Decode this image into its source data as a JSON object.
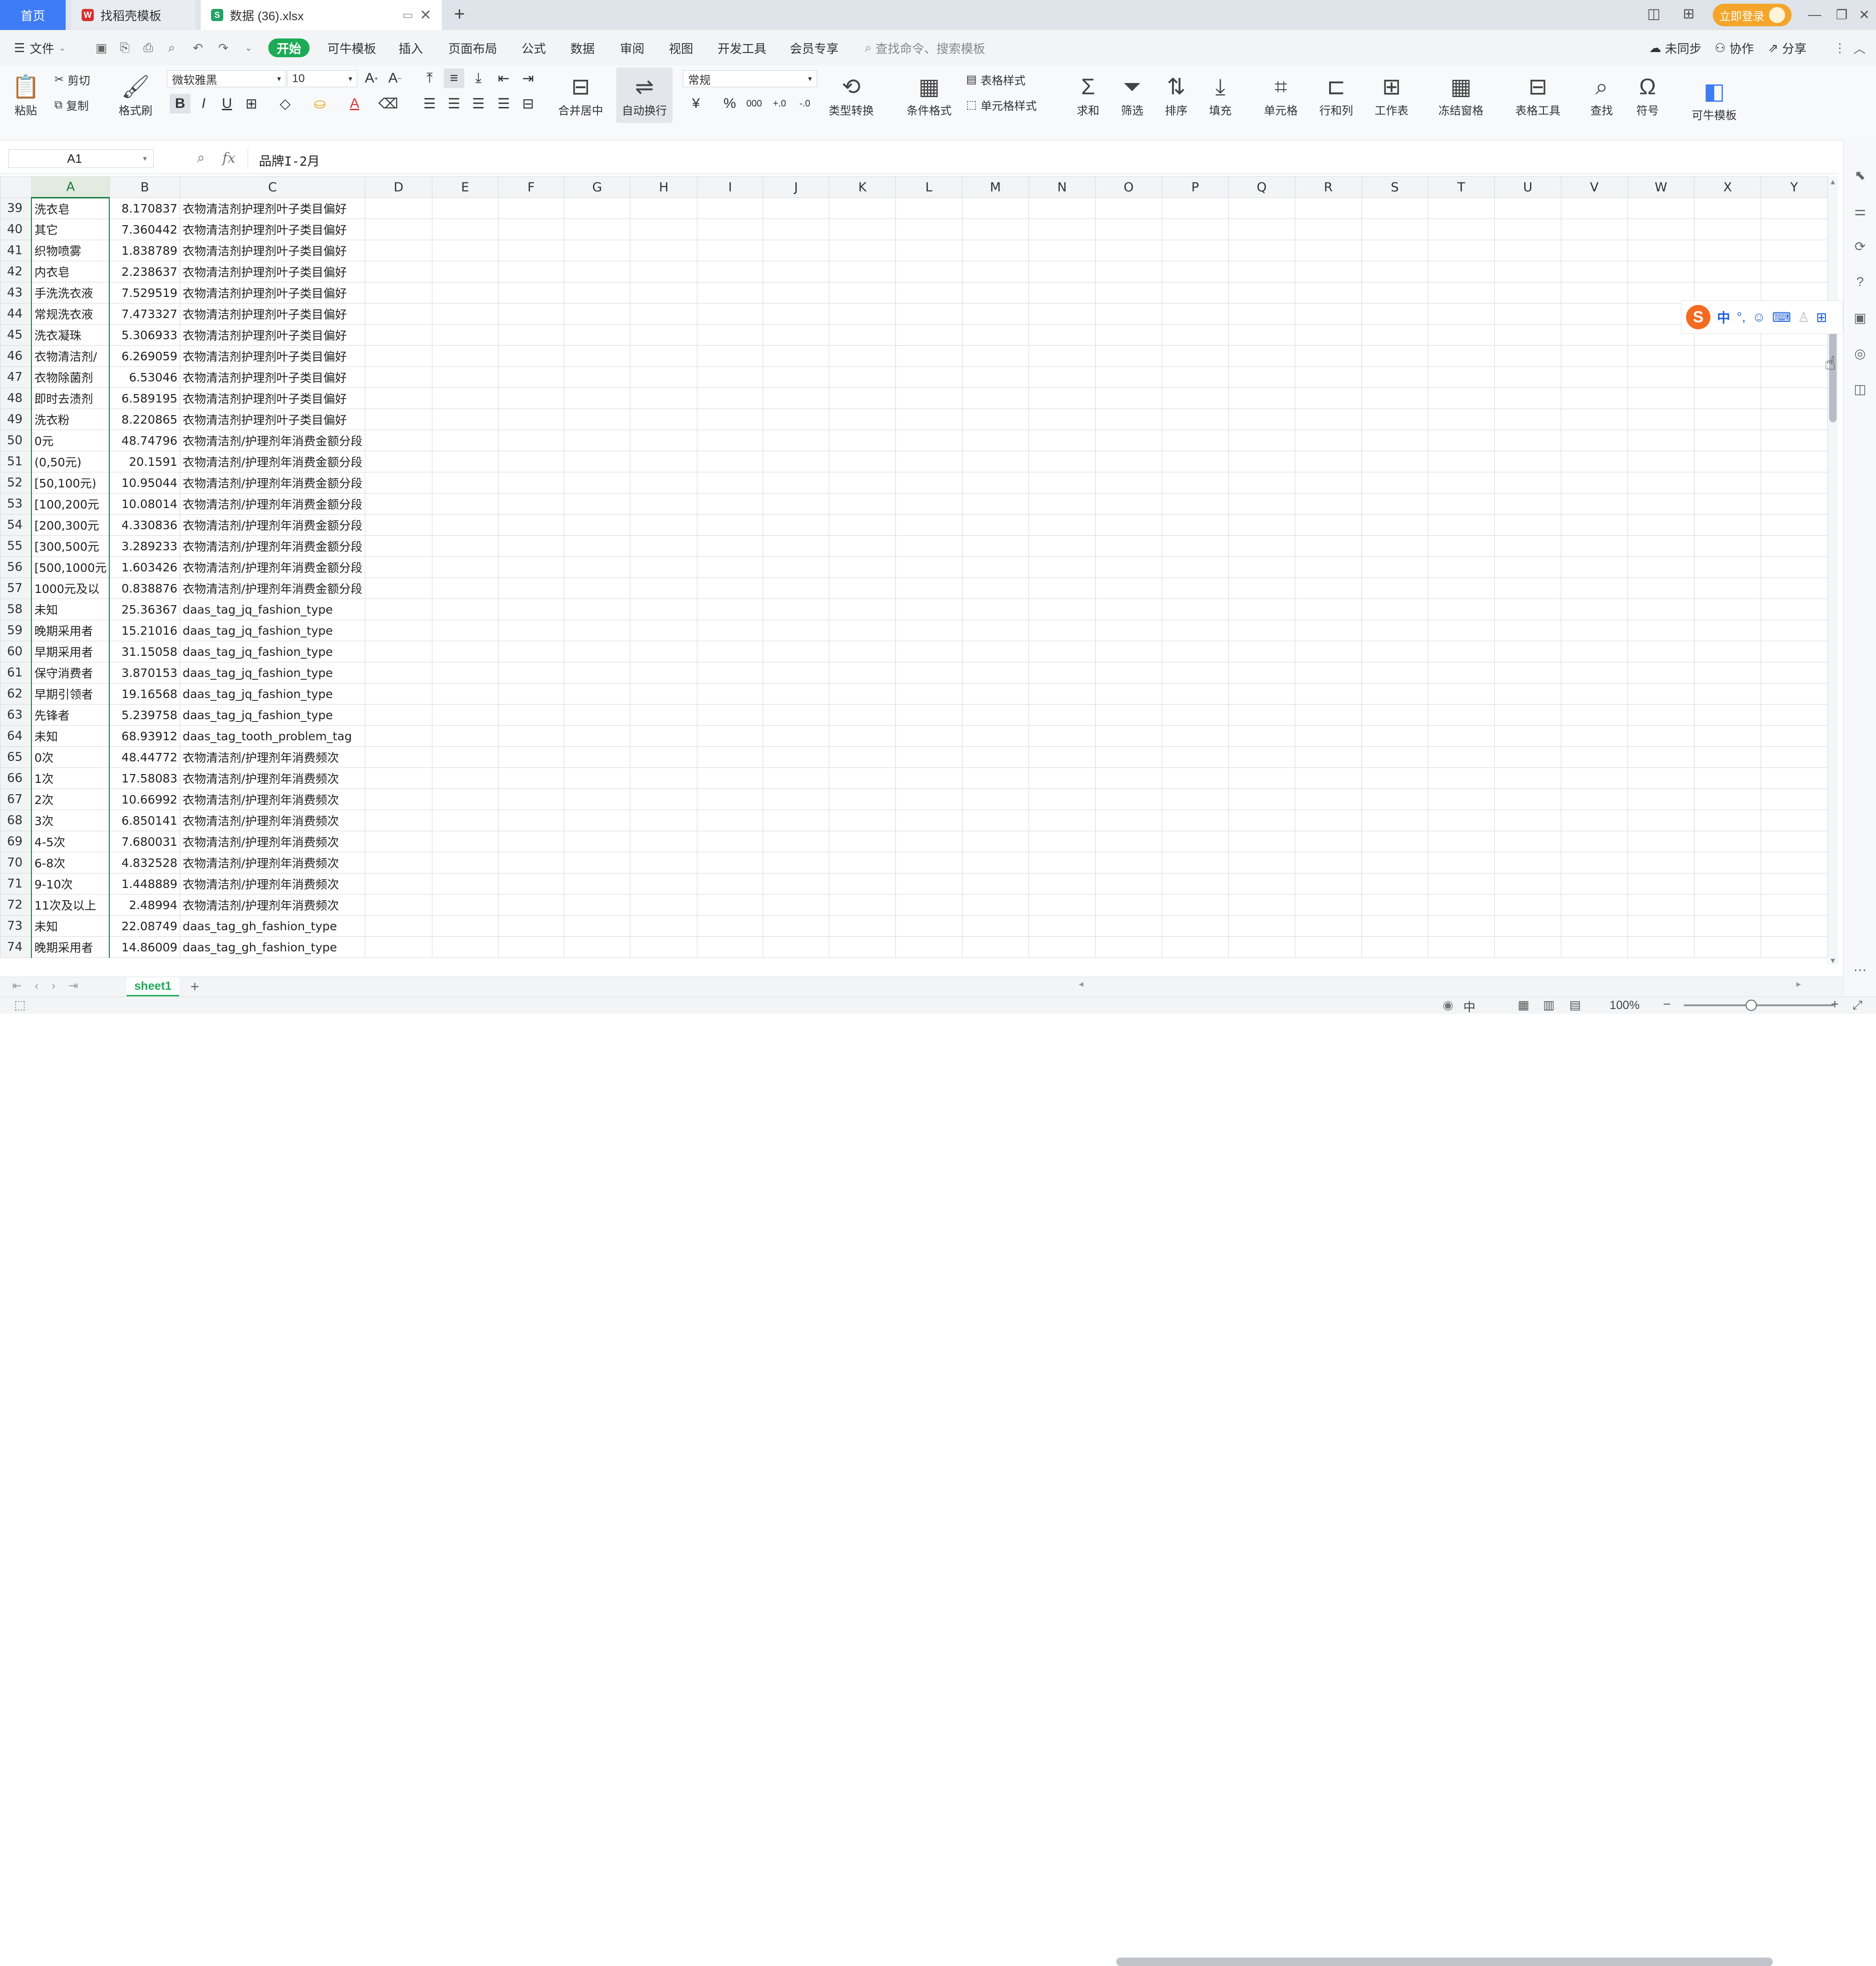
{
  "titlebar": {
    "tabs": [
      {
        "label": "首页"
      },
      {
        "label": "找稻壳模板"
      },
      {
        "label": "数据 (36).xlsx"
      }
    ],
    "new_tab": "+",
    "login_button": "立即登录"
  },
  "menubar": {
    "file": "文件",
    "items": [
      "开始",
      "可牛模板",
      "插入",
      "页面布局",
      "公式",
      "数据",
      "审阅",
      "视图",
      "开发工具",
      "会员专享"
    ],
    "search_placeholder": "查找命令、搜索模板",
    "right": [
      "未同步",
      "协作",
      "分享"
    ]
  },
  "ribbon": {
    "paste": "粘贴",
    "cut": "剪切",
    "copy": "复制",
    "format_painter": "格式刷",
    "font_name": "微软雅黑",
    "font_size": "10",
    "merge": "合并居中",
    "wrap": "自动换行",
    "number_format": "常规",
    "type_convert": "类型转换",
    "cond_format": "条件格式",
    "table_style": "表格样式",
    "cell_style": "单元格样式",
    "sum": "求和",
    "filter": "筛选",
    "sort": "排序",
    "fill": "填充",
    "cell": "单元格",
    "rowcol": "行和列",
    "worksheet": "工作表",
    "freeze": "冻结窗格",
    "table_tools": "表格工具",
    "find": "查找",
    "symbol": "符号",
    "keniu": "可牛模板"
  },
  "formula": {
    "name_box": "A1",
    "fx": "fx",
    "content": "品牌I-2月"
  },
  "columns": [
    "A",
    "B",
    "C",
    "D",
    "E",
    "F",
    "G",
    "H",
    "I",
    "J",
    "K",
    "L",
    "M",
    "N",
    "O",
    "P",
    "Q",
    "R",
    "S",
    "T",
    "U",
    "V",
    "W",
    "X",
    "Y"
  ],
  "rows": [
    {
      "n": "39",
      "a": "洗衣皂",
      "b": "8.170837",
      "c": "衣物清洁剂护理剂叶子类目偏好"
    },
    {
      "n": "40",
      "a": "其它",
      "b": "7.360442",
      "c": "衣物清洁剂护理剂叶子类目偏好"
    },
    {
      "n": "41",
      "a": "织物喷雾",
      "b": "1.838789",
      "c": "衣物清洁剂护理剂叶子类目偏好"
    },
    {
      "n": "42",
      "a": "内衣皂",
      "b": "2.238637",
      "c": "衣物清洁剂护理剂叶子类目偏好"
    },
    {
      "n": "43",
      "a": "手洗洗衣液",
      "b": "7.529519",
      "c": "衣物清洁剂护理剂叶子类目偏好"
    },
    {
      "n": "44",
      "a": "常规洗衣液",
      "b": "7.473327",
      "c": "衣物清洁剂护理剂叶子类目偏好"
    },
    {
      "n": "45",
      "a": "洗衣凝珠",
      "b": "5.306933",
      "c": "衣物清洁剂护理剂叶子类目偏好"
    },
    {
      "n": "46",
      "a": "衣物清洁剂/",
      "b": "6.269059",
      "c": "衣物清洁剂护理剂叶子类目偏好"
    },
    {
      "n": "47",
      "a": "衣物除菌剂",
      "b": "6.53046",
      "c": "衣物清洁剂护理剂叶子类目偏好"
    },
    {
      "n": "48",
      "a": "即时去渍剂",
      "b": "6.589195",
      "c": "衣物清洁剂护理剂叶子类目偏好"
    },
    {
      "n": "49",
      "a": "洗衣粉",
      "b": "8.220865",
      "c": "衣物清洁剂护理剂叶子类目偏好"
    },
    {
      "n": "50",
      "a": "0元",
      "b": "48.74796",
      "c": "衣物清洁剂/护理剂年消费金额分段"
    },
    {
      "n": "51",
      "a": "(0,50元)",
      "b": "20.1591",
      "c": "衣物清洁剂/护理剂年消费金额分段"
    },
    {
      "n": "52",
      "a": "[50,100元)",
      "b": "10.95044",
      "c": "衣物清洁剂/护理剂年消费金额分段"
    },
    {
      "n": "53",
      "a": "[100,200元",
      "b": "10.08014",
      "c": "衣物清洁剂/护理剂年消费金额分段"
    },
    {
      "n": "54",
      "a": "[200,300元",
      "b": "4.330836",
      "c": "衣物清洁剂/护理剂年消费金额分段"
    },
    {
      "n": "55",
      "a": "[300,500元",
      "b": "3.289233",
      "c": "衣物清洁剂/护理剂年消费金额分段"
    },
    {
      "n": "56",
      "a": "[500,1000元",
      "b": "1.603426",
      "c": "衣物清洁剂/护理剂年消费金额分段"
    },
    {
      "n": "57",
      "a": "1000元及以",
      "b": "0.838876",
      "c": "衣物清洁剂/护理剂年消费金额分段"
    },
    {
      "n": "58",
      "a": "未知",
      "b": "25.36367",
      "c": "daas_tag_jq_fashion_type"
    },
    {
      "n": "59",
      "a": "晚期采用者",
      "b": "15.21016",
      "c": "daas_tag_jq_fashion_type"
    },
    {
      "n": "60",
      "a": "早期采用者",
      "b": "31.15058",
      "c": "daas_tag_jq_fashion_type"
    },
    {
      "n": "61",
      "a": "保守消费者",
      "b": "3.870153",
      "c": "daas_tag_jq_fashion_type"
    },
    {
      "n": "62",
      "a": "早期引领者",
      "b": "19.16568",
      "c": "daas_tag_jq_fashion_type"
    },
    {
      "n": "63",
      "a": "先锋者",
      "b": "5.239758",
      "c": "daas_tag_jq_fashion_type"
    },
    {
      "n": "64",
      "a": "未知",
      "b": "68.93912",
      "c": "daas_tag_tooth_problem_tag"
    },
    {
      "n": "65",
      "a": "0次",
      "b": "48.44772",
      "c": "衣物清洁剂/护理剂年消费频次"
    },
    {
      "n": "66",
      "a": "1次",
      "b": "17.58083",
      "c": "衣物清洁剂/护理剂年消费频次"
    },
    {
      "n": "67",
      "a": "2次",
      "b": "10.66992",
      "c": "衣物清洁剂/护理剂年消费频次"
    },
    {
      "n": "68",
      "a": "3次",
      "b": "6.850141",
      "c": "衣物清洁剂/护理剂年消费频次"
    },
    {
      "n": "69",
      "a": "4-5次",
      "b": "7.680031",
      "c": "衣物清洁剂/护理剂年消费频次"
    },
    {
      "n": "70",
      "a": "6-8次",
      "b": "4.832528",
      "c": "衣物清洁剂/护理剂年消费频次"
    },
    {
      "n": "71",
      "a": "9-10次",
      "b": "1.448889",
      "c": "衣物清洁剂/护理剂年消费频次"
    },
    {
      "n": "72",
      "a": "11次及以上",
      "b": "2.48994",
      "c": "衣物清洁剂/护理剂年消费频次"
    },
    {
      "n": "73",
      "a": "未知",
      "b": "22.08749",
      "c": "daas_tag_gh_fashion_type"
    },
    {
      "n": "74",
      "a": "晚期采用者",
      "b": "14.86009",
      "c": "daas_tag_gh_fashion_type"
    }
  ],
  "sheet_tabs": [
    "sheet1"
  ],
  "status": {
    "input_mode": "中",
    "zoom": "100%"
  },
  "ime": {
    "mode": "中"
  }
}
